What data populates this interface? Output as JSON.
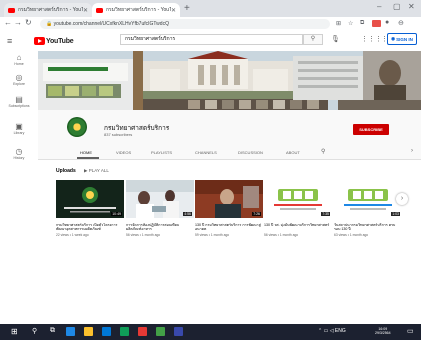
{
  "browser": {
    "tabs": [
      {
        "label": "กรมวิทยาศาสตร์บริการ - YouTube"
      },
      {
        "label": "กรมวิทยาศาสตร์บริการ - YouTube"
      }
    ],
    "address": "youtube.com/channel/UCxfknXLHvYfb7ufcIGTwdcQ"
  },
  "youtube": {
    "logo_text": "YouTube",
    "search_value": "กรมวิทยาศาสตร์บริการ",
    "signin_label": "SIGN IN"
  },
  "sidebar": {
    "items": [
      {
        "label": "Home",
        "icon": "home-icon"
      },
      {
        "label": "Explore",
        "icon": "compass-icon"
      },
      {
        "label": "Subscriptions",
        "icon": "subscriptions-icon"
      },
      {
        "label": "Library",
        "icon": "library-icon"
      },
      {
        "label": "History",
        "icon": "history-icon"
      }
    ]
  },
  "channel": {
    "name": "กรมวิทยาศาสตร์บริการ",
    "subscribers": "837 subscribers",
    "subscribe_label": "SUBSCRIBE",
    "tabs": [
      {
        "label": "HOME"
      },
      {
        "label": "VIDEOS"
      },
      {
        "label": "PLAYLISTS"
      },
      {
        "label": "CHANNELS"
      },
      {
        "label": "DISCUSSION"
      },
      {
        "label": "ABOUT"
      }
    ]
  },
  "uploads": {
    "title": "Uploads",
    "play_all": "PLAY ALL",
    "videos": [
      {
        "title": "กรมวิทยาศาสตร์บริการ เปิดตัวโครงการพัฒนาอุตสาหกรรมผลิตภัณฑ์",
        "meta": "22 views • 1 week ago",
        "duration": "10:49"
      },
      {
        "title": "การจัดการห้องปฏิบัติการสอบเทียบผลิตภัณฑ์อาหาร",
        "meta": "56 views • 1 month ago",
        "duration": "4:56"
      },
      {
        "title": "130 ปี กรมวิทยาศาสตร์บริการ การพัฒนาสู่อนาคต",
        "meta": "59 views • 1 month ago",
        "duration": "7:26"
      },
      {
        "title": "130 ปี วศ. มุ่งมั่นพัฒนาบริการวิทยาศาสตร์",
        "meta": "56 views • 1 month ago",
        "duration": "7:35"
      },
      {
        "title": "วันสถาปนากรมวิทยาศาสตร์บริการ ครบรอบ 130 ปี",
        "meta": "63 views • 1 month ago",
        "duration": "1:03"
      }
    ]
  },
  "taskbar": {
    "time": "16:09",
    "date": "29/3/2564"
  },
  "colors": {
    "brand_red": "#ff0000",
    "subscribe_red": "#cc0000",
    "signin_blue": "#065fd4"
  }
}
